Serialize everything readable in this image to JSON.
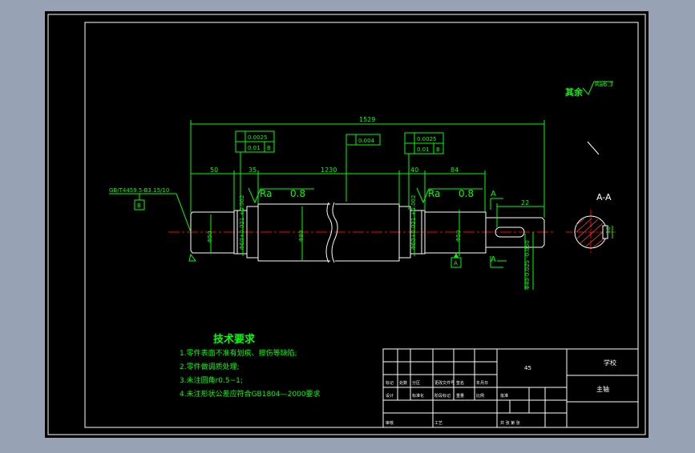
{
  "drawing": {
    "surface_note": "其余",
    "surface_roughness": "Ra6.3",
    "overall_length": "1529",
    "dims_top": [
      "50",
      "35",
      "1230",
      "40",
      "84"
    ],
    "dim_22": "22",
    "keyway_dim": "10",
    "gdt_left": {
      "row1": "0.0025",
      "row2_tol": "0.01",
      "row2_ref": "B"
    },
    "gdt_mid": {
      "row1": "0.004"
    },
    "gdt_right": {
      "row1": "0.0025",
      "row2_tol": "0.01",
      "row2_ref": "B"
    },
    "center_hole_label": "GB/T4459.5-B3.15/10",
    "datum_b": "B",
    "datum_a": "A",
    "ra_left": "Ra",
    "ra_left_value": "0.8",
    "ra_right": "Ra",
    "ra_right_value": "0.8",
    "section_mark_a": "A",
    "section_title": "A-A",
    "dia_left_end": "Φ50",
    "dia_left_bearing": "Φ60+0.021 +0.002",
    "dia_main": "Φ80",
    "dia_right_bearing": "Φ60+0.021 +0.002",
    "dia_right_mid": "Φ50",
    "dia_right_end": "Φ40-0.025 -0.050"
  },
  "requirements": {
    "title": "技术要求",
    "items": [
      "1.零件表面不准有划痕、擦伤等缺陷;",
      "2.零件做调质处理;",
      "3.未注圆角r0.5~1;",
      "4.未注形状公差应符合GB1804—2000要求"
    ]
  },
  "title_block": {
    "material_code": "45",
    "school": "学校",
    "part_name": "主轴",
    "row_labels": [
      "标记",
      "处数",
      "分区",
      "更改文件号",
      "签名",
      "年月日"
    ],
    "row2_labels": [
      "设计",
      "标准化",
      "阶段标记",
      "重量",
      "比例"
    ],
    "row3_labels": [
      "审核",
      "工艺",
      "批准",
      "共 张 第 张"
    ],
    "sheet_text": "共  张  第  张"
  }
}
